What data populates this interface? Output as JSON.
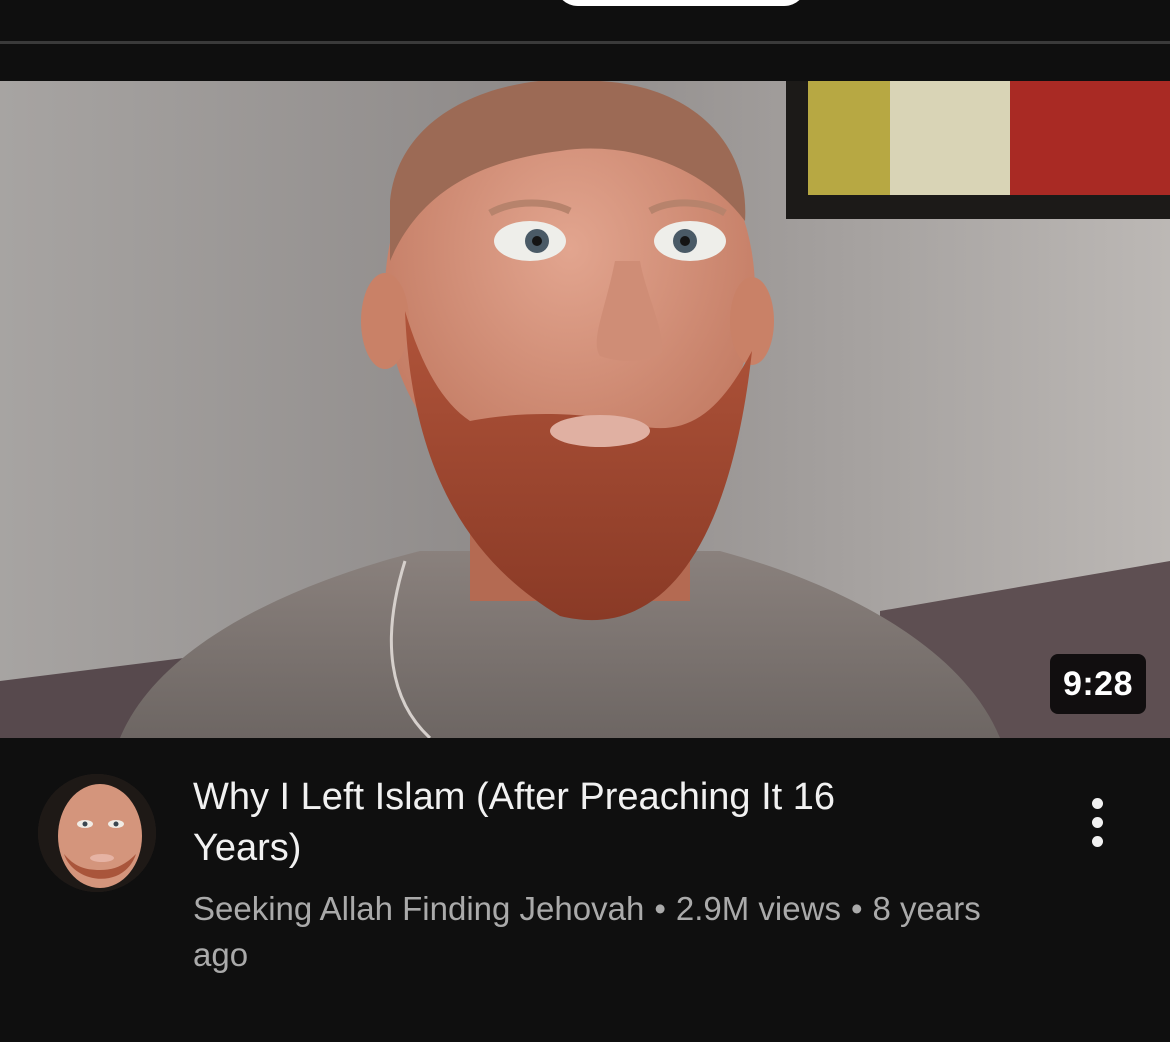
{
  "video": {
    "duration": "9:28",
    "title": "Why I Left Islam (After Preaching It 16 Years)",
    "channel": "Seeking Allah Finding Jehovah",
    "separator": "•",
    "views": "2.9M views",
    "age": "8 years ago"
  },
  "icons": {
    "more": "more-vertical-icon",
    "avatar": "channel-avatar"
  },
  "colors": {
    "background": "#0f0f0f",
    "title_text": "#f1f1f1",
    "meta_text": "#aaaaaa",
    "badge_bg": "#000000"
  }
}
